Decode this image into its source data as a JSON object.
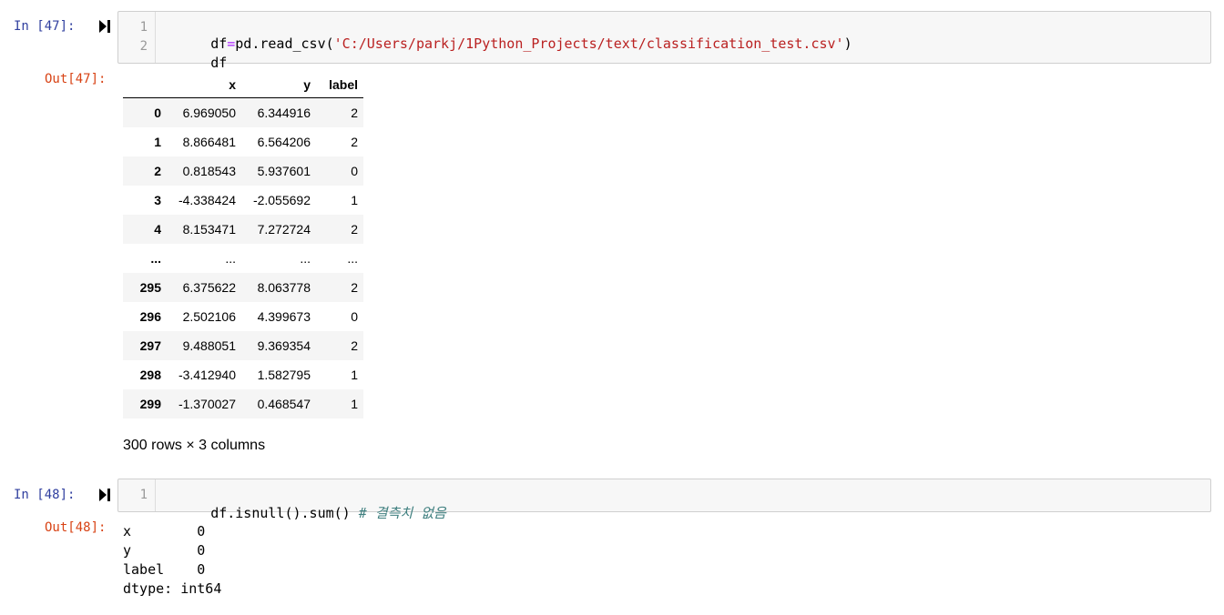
{
  "cells": [
    {
      "in_prompt": "In [47]:",
      "out_prompt": "Out[47]:",
      "code_lines": [
        {
          "number": "1",
          "tokens": [
            {
              "kind": "plain",
              "text": "df"
            },
            {
              "kind": "op",
              "text": "="
            },
            {
              "kind": "plain",
              "text": "pd.read_csv("
            },
            {
              "kind": "str",
              "text": "'C:/Users/parkj/1Python_Projects/text/classification_test.csv'"
            },
            {
              "kind": "plain",
              "text": ")"
            }
          ]
        },
        {
          "number": "2",
          "tokens": [
            {
              "kind": "plain",
              "text": "df"
            }
          ]
        }
      ],
      "dataframe": {
        "columns": [
          "",
          "x",
          "y",
          "label"
        ],
        "rows": [
          [
            "0",
            "6.969050",
            "6.344916",
            "2"
          ],
          [
            "1",
            "8.866481",
            "6.564206",
            "2"
          ],
          [
            "2",
            "0.818543",
            "5.937601",
            "0"
          ],
          [
            "3",
            "-4.338424",
            "-2.055692",
            "1"
          ],
          [
            "4",
            "8.153471",
            "7.272724",
            "2"
          ],
          [
            "...",
            "...",
            "...",
            "..."
          ],
          [
            "295",
            "6.375622",
            "8.063778",
            "2"
          ],
          [
            "296",
            "2.502106",
            "4.399673",
            "0"
          ],
          [
            "297",
            "9.488051",
            "9.369354",
            "2"
          ],
          [
            "298",
            "-3.412940",
            "1.582795",
            "1"
          ],
          [
            "299",
            "-1.370027",
            "0.468547",
            "1"
          ]
        ],
        "shape_note": "300 rows × 3 columns"
      }
    },
    {
      "in_prompt": "In [48]:",
      "out_prompt": "Out[48]:",
      "code_lines": [
        {
          "number": "1",
          "tokens": [
            {
              "kind": "plain",
              "text": "df.isnull().sum() "
            },
            {
              "kind": "com",
              "text": "# 결측치 없음"
            }
          ]
        }
      ],
      "output_text": "x        0\ny        0\nlabel    0\ndtype: int64"
    }
  ],
  "icons": {
    "run": "run-cell-icon"
  },
  "colors": {
    "in_prompt": "#303f9f",
    "out_prompt": "#d84315",
    "string": "#ba2121",
    "operator": "#aa22ff",
    "comment": "#408080",
    "input_bg": "#f7f7f7"
  }
}
